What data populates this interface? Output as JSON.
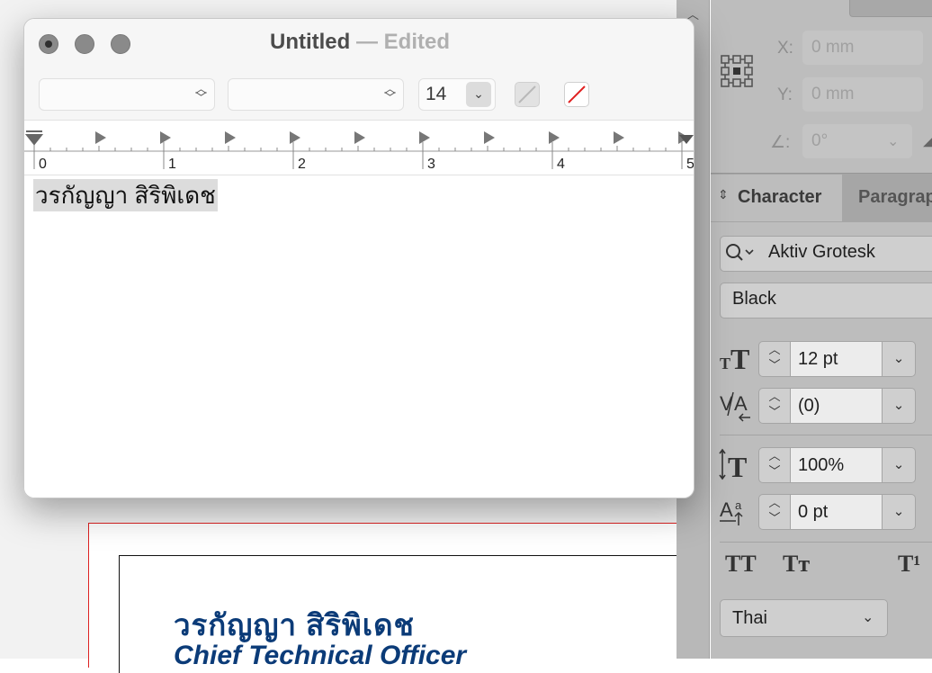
{
  "window": {
    "title": "Untitled",
    "separator": "—",
    "status": "Edited",
    "font_size": "14",
    "text_content": "วรกัญญา สิริพิเดช"
  },
  "ruler": {
    "labels": [
      "0",
      "1",
      "2",
      "3",
      "4",
      "5"
    ]
  },
  "background_document": {
    "heading": "วรกัญญา สิริพิเดช",
    "subtitle": "Chief Technical Officer",
    "text_color": "#0b3b78",
    "frame_color": "#dd2222"
  },
  "transform": {
    "x_label": "X:",
    "x_value": "0 mm",
    "y_label": "Y:",
    "y_value": "0 mm",
    "angle_label": "∠:",
    "angle_value": "0°"
  },
  "panel": {
    "tabs": [
      {
        "label": "Character",
        "active": true
      },
      {
        "label": "Paragraph",
        "active": false
      }
    ],
    "font_family": "Aktiv Grotesk",
    "font_style": "Black",
    "font_size": "12 pt",
    "kerning": "(0)",
    "vertical_scale": "100%",
    "baseline_shift": "0 pt",
    "language": "Thai",
    "style_buttons": [
      "TT",
      "Tт",
      "T¹"
    ],
    "icons": [
      "font-size-icon",
      "kerning-icon",
      "vertical-scale-icon",
      "baseline-shift-icon",
      "search-icon",
      "reference-point-icon"
    ]
  }
}
